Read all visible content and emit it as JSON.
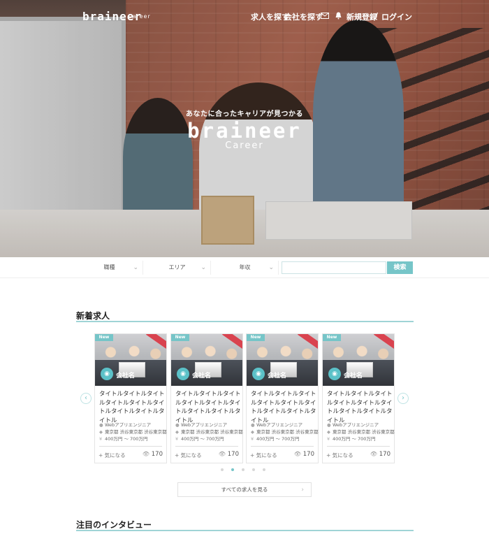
{
  "header": {
    "logo": "braineer",
    "logo_sub": "Career",
    "nav": {
      "find_jobs": "求人を探す",
      "find_companies": "会社を探す",
      "mail_icon": "mail-icon",
      "bell_icon": "bell-icon",
      "register": "新規登録",
      "separator": "/",
      "login": "ログイン"
    }
  },
  "hero": {
    "tagline": "あなたに合ったキャリアが見つかる",
    "title": "braineer",
    "subtitle": "Career"
  },
  "search": {
    "job_type": "職種",
    "area": "エリア",
    "income": "年収",
    "keyword_value": "",
    "button": "検索"
  },
  "new_jobs": {
    "heading": "新着求人",
    "cards": [
      {
        "new": "New",
        "company": "会社名",
        "title": "タイトルタイトルタイトルタイトルタイトルタイトルタイトルタイトルタイトル",
        "role": "Webアプリエンジニア",
        "location": "東京都 渋谷東京都 渋谷東京都",
        "salary": "400万円 〜 700万円",
        "fav": "+ 気になる",
        "views": "170"
      },
      {
        "new": "New",
        "company": "会社名",
        "title": "タイトルタイトルタイトルタイトルタイトルタイトルタイトルタイトルタイトル",
        "role": "Webアプリエンジニア",
        "location": "東京都 渋谷東京都 渋谷東京都",
        "salary": "400万円 〜 700万円",
        "fav": "+ 気になる",
        "views": "170"
      },
      {
        "new": "New",
        "company": "会社名",
        "title": "タイトルタイトルタイトルタイトルタイトルタイトルタイトルタイトルタイトル",
        "role": "Webアプリエンジニア",
        "location": "東京都 渋谷東京都 渋谷東京都",
        "salary": "400万円 〜 700万円",
        "fav": "+ 気になる",
        "views": "170"
      },
      {
        "new": "New",
        "company": "会社名",
        "title": "タイトルタイトルタイトルタイトルタイトルタイトルタイトルタイトルタイトル",
        "role": "Webアプリエンジニア",
        "location": "東京都 渋谷東京都 渋谷東京都",
        "salary": "400万円 〜 700万円",
        "fav": "+ 気になる",
        "views": "170"
      }
    ],
    "pager_active": 2,
    "pager_count": 5,
    "see_all": "すべての求人を見る"
  },
  "interviews": {
    "heading": "注目のインタビュー"
  },
  "colors": {
    "accent": "#76c5c8",
    "ribbon": "#d9434f"
  }
}
